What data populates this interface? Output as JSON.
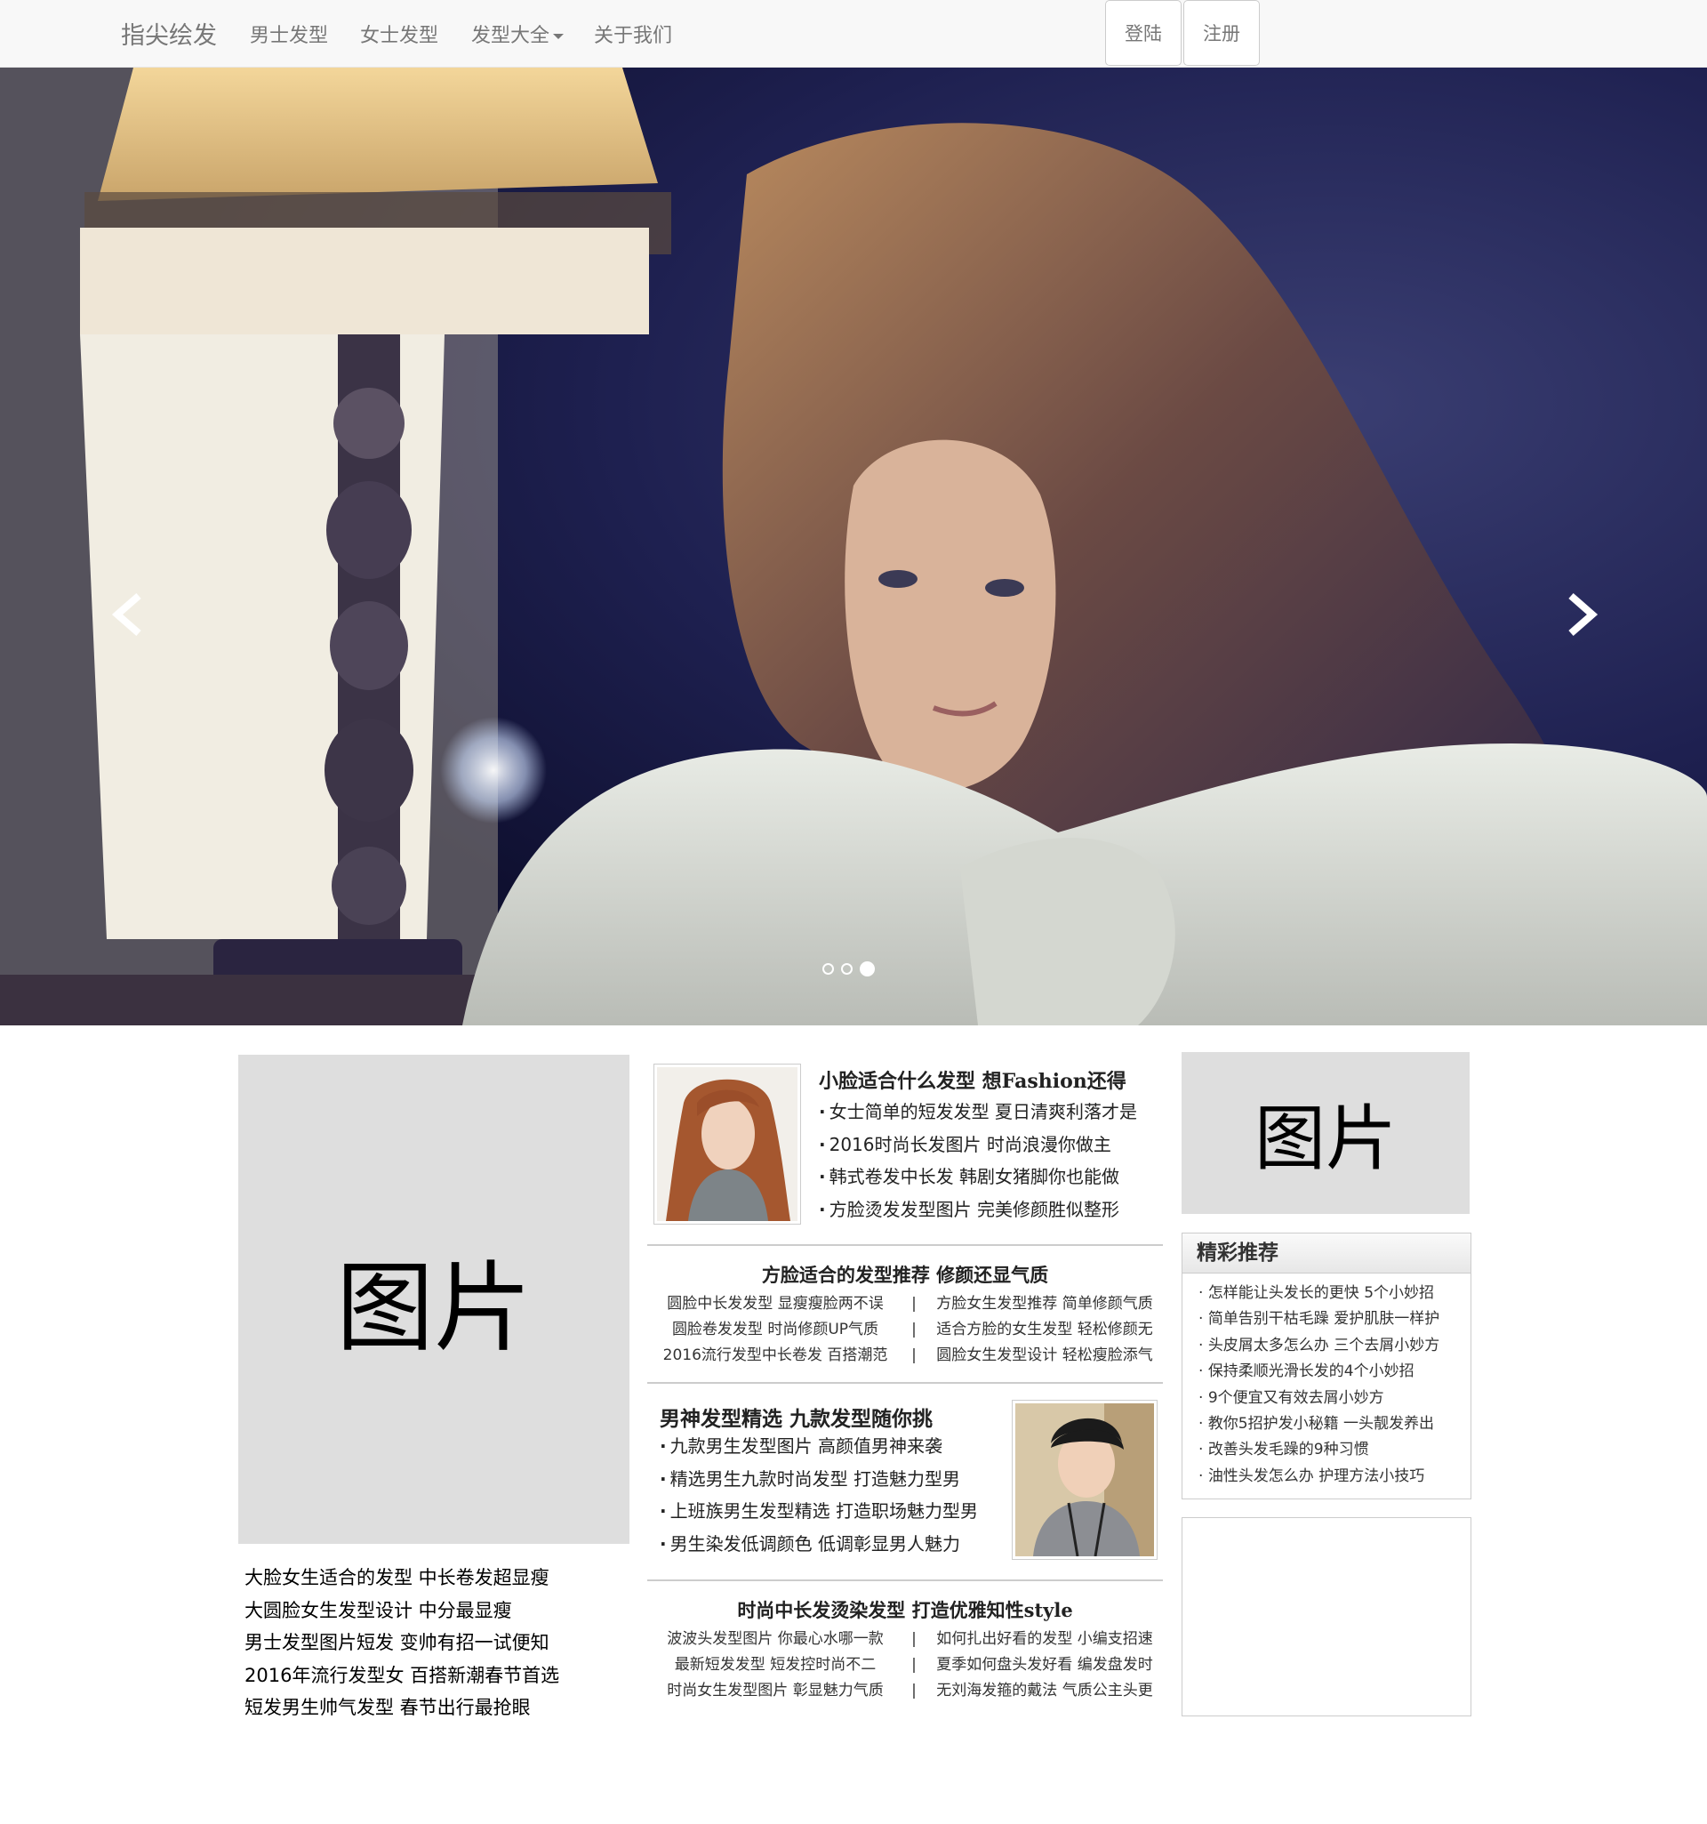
{
  "navbar": {
    "brand": "指尖绘发",
    "items": [
      {
        "label": "男士发型"
      },
      {
        "label": "女士发型"
      },
      {
        "label": "发型大全"
      },
      {
        "label": "关于我们"
      }
    ],
    "login": "登陆",
    "register": "注册"
  },
  "carousel": {
    "slide_count": 3,
    "active_index": 2
  },
  "left": {
    "placeholder": "图片",
    "links": [
      "大脸女生适合的发型 中长卷发超显瘦",
      "大圆脸女生发型设计 中分最显瘦",
      "男士发型图片短发 变帅有招一试便知",
      "2016年流行发型女 百搭新潮春节首选",
      "短发男生帅气发型 春节出行最抢眼"
    ]
  },
  "middle": {
    "block1": {
      "title": "小脸适合什么发型 想Fashion还得",
      "items": [
        "女士简单的短发发型 夏日清爽利落才是",
        "2016时尚长发图片 时尚浪漫你做主",
        "韩式卷发中长发 韩剧女猪脚你也能做",
        "方脸烫发发型图片 完美修颜胜似整形"
      ]
    },
    "block2": {
      "title": "方脸适合的发型推荐 修颜还显气质",
      "rows": [
        [
          "圆脸中长发发型 显瘦瘦脸两不误",
          "方脸女生发型推荐 简单修颜气质"
        ],
        [
          "圆脸卷发发型 时尚修颜UP气质",
          "适合方脸的女生发型 轻松修颜无"
        ],
        [
          "2016流行发型中长卷发 百搭潮范",
          "圆脸女生发型设计 轻松瘦脸添气"
        ]
      ]
    },
    "block3": {
      "title": "男神发型精选 九款发型随你挑",
      "items": [
        "九款男生发型图片 高颜值男神来袭",
        "精选男生九款时尚发型 打造魅力型男",
        "上班族男生发型精选 打造职场魅力型男",
        "男生染发低调颜色 低调彰显男人魅力"
      ]
    },
    "block4": {
      "title": "时尚中长发烫染发型 打造优雅知性style",
      "rows": [
        [
          "波波头发型图片 你最心水哪一款",
          "如何扎出好看的发型 小编支招速"
        ],
        [
          "最新短发发型 短发控时尚不二",
          "夏季如何盘头发好看 编发盘发时"
        ],
        [
          "时尚女生发型图片 彰显魅力气质",
          "无刘海发箍的戴法 气质公主头更"
        ]
      ]
    },
    "separator": "|"
  },
  "right": {
    "placeholder": "图片",
    "rec_title": "精彩推荐",
    "rec_items": [
      "怎样能让头发长的更快 5个小妙招",
      "简单告别干枯毛躁 爱护肌肤一样护",
      "头皮屑太多怎么办 三个去屑小妙方",
      "保持柔顺光滑长发的4个小妙招",
      "9个便宜又有效去屑小妙方",
      "教你5招护发小秘籍 一头靓发养出",
      "改善头发毛躁的9种习惯",
      "油性头发怎么办 护理方法小技巧"
    ]
  }
}
